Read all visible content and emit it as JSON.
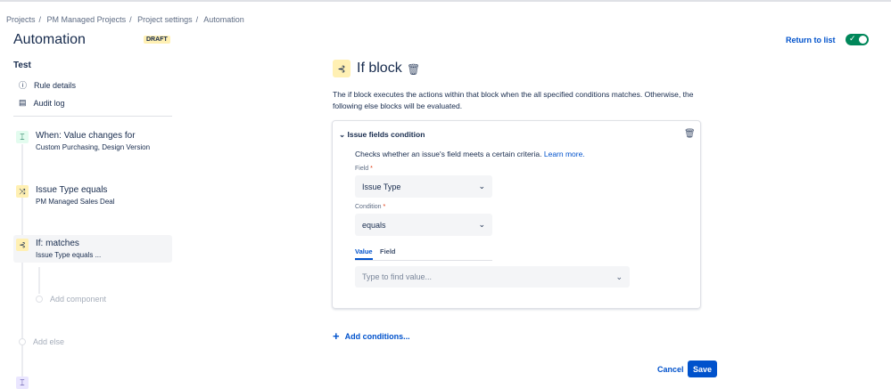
{
  "breadcrumbs": [
    "Projects",
    "PM Managed Projects",
    "Project settings",
    "Automation"
  ],
  "page_title": "Automation",
  "status_badge": "DRAFT",
  "return_link": "Return to list",
  "toggle": {
    "enabled": true
  },
  "rule": {
    "name": "Test",
    "nav": [
      {
        "label": "Rule details",
        "icon": "info-icon"
      },
      {
        "label": "Audit log",
        "icon": "audit-log-icon"
      }
    ]
  },
  "components": [
    {
      "title": "When: Value changes for",
      "subtitle": "Custom Purchasing, Design Version",
      "icon": "trigger-icon",
      "color": "#e3fcef"
    },
    {
      "title": "Issue Type equals",
      "subtitle": "PM Managed Sales Deal",
      "icon": "condition-icon",
      "color": "#fff0b3"
    },
    {
      "title": "If: matches",
      "subtitle": "Issue Type equals ...",
      "icon": "branch-icon",
      "color": "#fff0b3"
    }
  ],
  "add_component": "Add component",
  "add_else": "Add else",
  "panel": {
    "title": "If block",
    "description": "The if block executes the actions within that block when the all specified conditions matches. Otherwise, the following else blocks will be evaluated.",
    "condition": {
      "title": "Issue fields condition",
      "help": "Checks whether an issue's field meets a certain criteria.",
      "learn_more": "Learn more.",
      "field_label": "Field",
      "field_value": "Issue Type",
      "condition_label": "Condition",
      "condition_value": "equals",
      "tabs": [
        "Value",
        "Field"
      ],
      "value_placeholder": "Type to find value..."
    },
    "add_conditions": "Add conditions...",
    "cancel": "Cancel",
    "save": "Save"
  }
}
